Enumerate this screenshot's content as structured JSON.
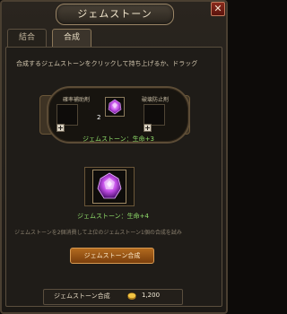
{
  "window": {
    "title": "ジェムストーン",
    "close_label": "✕"
  },
  "tabs": [
    {
      "label": "結合"
    },
    {
      "label": "合成"
    }
  ],
  "main": {
    "instruction": "合成するジェムストーンをクリックして持ち上げるか、ドラッグ",
    "slot_left_label": "確率補助剤",
    "slot_right_label": "破壊防止剤",
    "plus_symbol": "+",
    "gem_count": "2",
    "gem_small_label": "ジェムストーン：生命+3",
    "gem_large_label": "ジェムストーン：生命+4",
    "footnote": "ジェムストーンを2個消費して上位のジェムストーン1個の合成を試み",
    "synth_button": "ジェムストーン合成"
  },
  "cost": {
    "label": "ジェムストーン合成",
    "value": "1,200"
  },
  "colors": {
    "gem": "#c44fe8",
    "stat_text": "#8fdc6a",
    "button": "#b26a1e"
  },
  "icons": {
    "gem": "purple-gem-icon",
    "coin": "gold-coin-icon"
  }
}
